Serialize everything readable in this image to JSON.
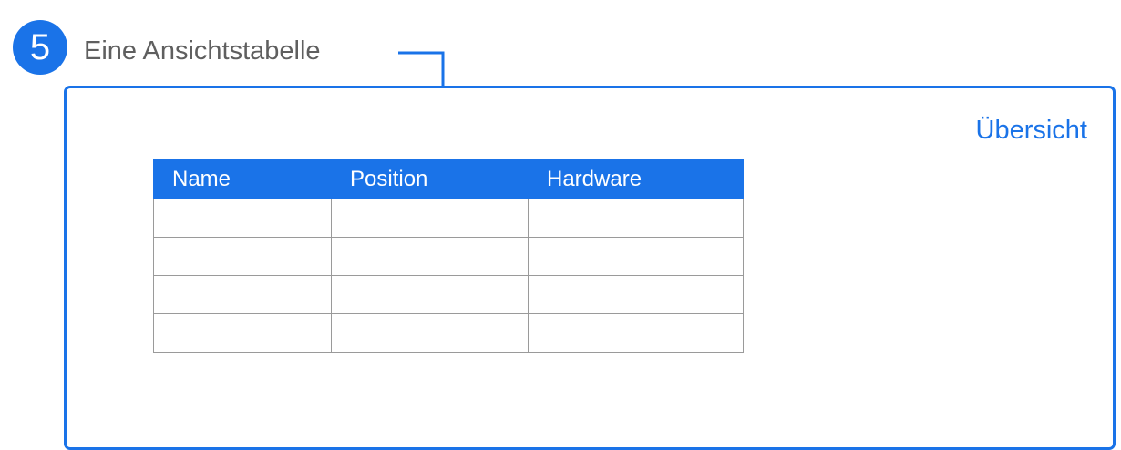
{
  "step": {
    "number": "5",
    "label": "Eine Ansichtstabelle"
  },
  "panel": {
    "title": "Übersicht"
  },
  "table": {
    "columns": [
      "Name",
      "Position",
      "Hardware"
    ],
    "rows": [
      [
        "",
        "",
        ""
      ],
      [
        "",
        "",
        ""
      ],
      [
        "",
        "",
        ""
      ],
      [
        "",
        "",
        ""
      ]
    ]
  },
  "colors": {
    "accent": "#1a73e8",
    "label_text": "#5f5f5f",
    "grid_lines": "#9a9a9a"
  }
}
